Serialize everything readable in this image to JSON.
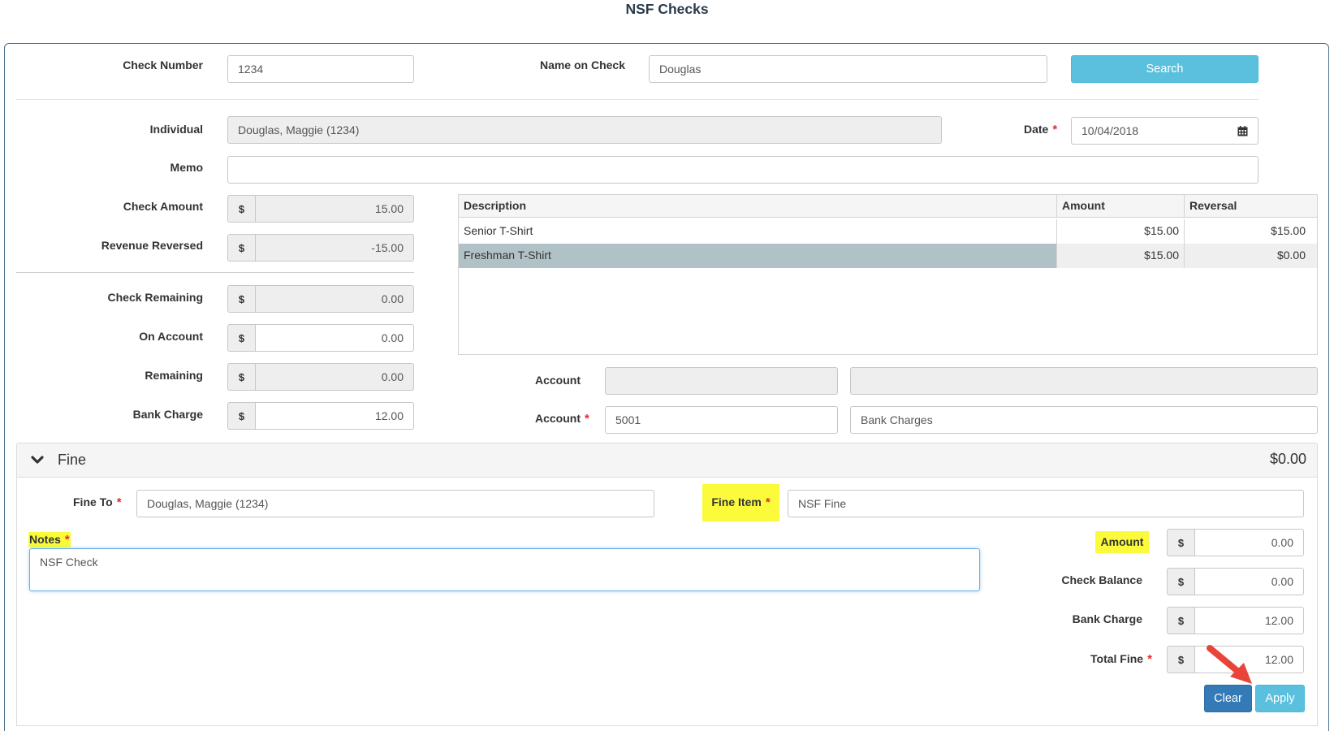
{
  "page": {
    "title": "NSF Checks"
  },
  "search": {
    "check_number_label": "Check Number",
    "check_number_value": "1234",
    "name_label": "Name on Check",
    "name_value": "Douglas",
    "search_button": "Search"
  },
  "details": {
    "individual_label": "Individual",
    "individual_value": "Douglas, Maggie (1234)",
    "date_label": "Date",
    "date_value": "10/04/2018",
    "memo_label": "Memo",
    "memo_value": "",
    "currency_symbol": "$",
    "check_amount_label": "Check Amount",
    "check_amount_value": "15.00",
    "revenue_reversed_label": "Revenue Reversed",
    "revenue_reversed_value": "-15.00",
    "check_remaining_label": "Check Remaining",
    "check_remaining_value": "0.00",
    "on_account_label": "On Account",
    "on_account_value": "0.00",
    "remaining_label": "Remaining",
    "remaining_value": "0.00",
    "bank_charge_label": "Bank Charge",
    "bank_charge_value": "12.00"
  },
  "items_table": {
    "headers": [
      "Description",
      "Amount",
      "Reversal"
    ],
    "rows": [
      {
        "description": "Senior T-Shirt",
        "amount": "$15.00",
        "reversal": "$15.00",
        "selected": false
      },
      {
        "description": "Freshman T-Shirt",
        "amount": "$15.00",
        "reversal": "$0.00",
        "selected": true
      }
    ]
  },
  "accounts": {
    "account_label": "Account",
    "account1_number": "",
    "account1_name": "",
    "account2_label": "Account",
    "account2_number": "5001",
    "account2_name": "Bank Charges"
  },
  "fine": {
    "section_title": "Fine",
    "section_total": "$0.00",
    "fine_to_label": "Fine To",
    "fine_to_value": "Douglas, Maggie (1234)",
    "fine_item_label": "Fine Item",
    "fine_item_value": "NSF Fine",
    "notes_label": "Notes",
    "notes_value": "NSF Check",
    "amount_label": "Amount",
    "amount_value": "0.00",
    "check_balance_label": "Check Balance",
    "check_balance_value": "0.00",
    "bank_charge_label": "Bank Charge",
    "bank_charge_value": "12.00",
    "total_fine_label": "Total Fine",
    "total_fine_value": "12.00",
    "clear_button": "Clear",
    "apply_button": "Apply"
  },
  "required_marker": "*",
  "colors": {
    "title": "#2a3b4c",
    "highlight": "#fbfb3c",
    "required": "#e52b2b",
    "info_button": "#5bc0de",
    "primary_button": "#337ab7",
    "selected_row": "#b0c2c6",
    "annotation_arrow": "#e8443a"
  },
  "icons": {
    "calendar": "calendar-icon",
    "collapse": "chevron-down-icon",
    "annotation": "arrow-icon"
  }
}
